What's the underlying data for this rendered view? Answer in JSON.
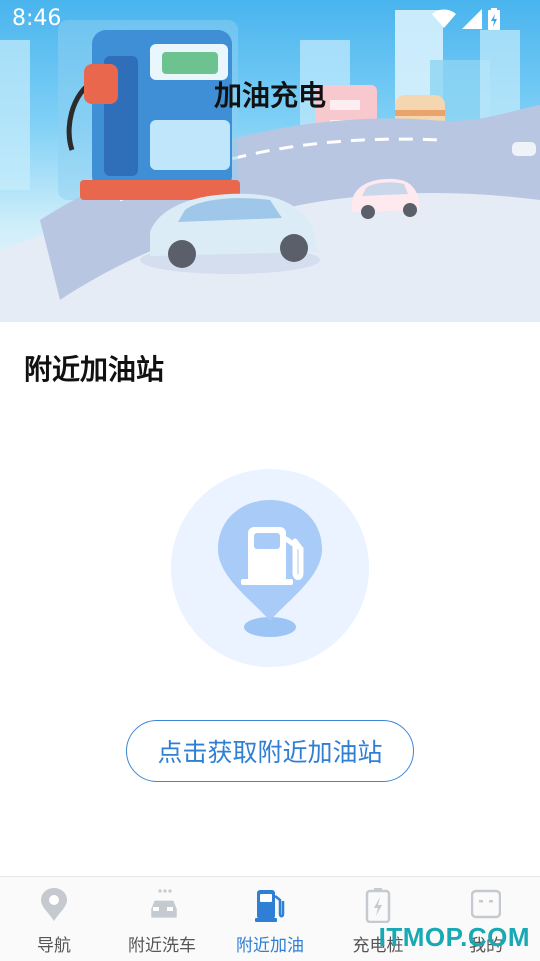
{
  "status_bar": {
    "time": "8:46"
  },
  "header": {
    "title": "加油充电"
  },
  "section": {
    "title": "附近加油站"
  },
  "empty_state": {
    "button_label": "点击获取附近加油站"
  },
  "tabbar": {
    "items": [
      {
        "label": "导航",
        "icon": "map-pin-icon"
      },
      {
        "label": "附近洗车",
        "icon": "car-wash-icon"
      },
      {
        "label": "附近加油",
        "icon": "fuel-pump-icon"
      },
      {
        "label": "充电桩",
        "icon": "charging-battery-icon"
      },
      {
        "label": "我的",
        "icon": "profile-icon"
      }
    ],
    "active_index": 2
  },
  "watermark": "ITMOP.COM",
  "colors": {
    "accent": "#2f7fd4",
    "illustration": "#9cc4f5"
  }
}
